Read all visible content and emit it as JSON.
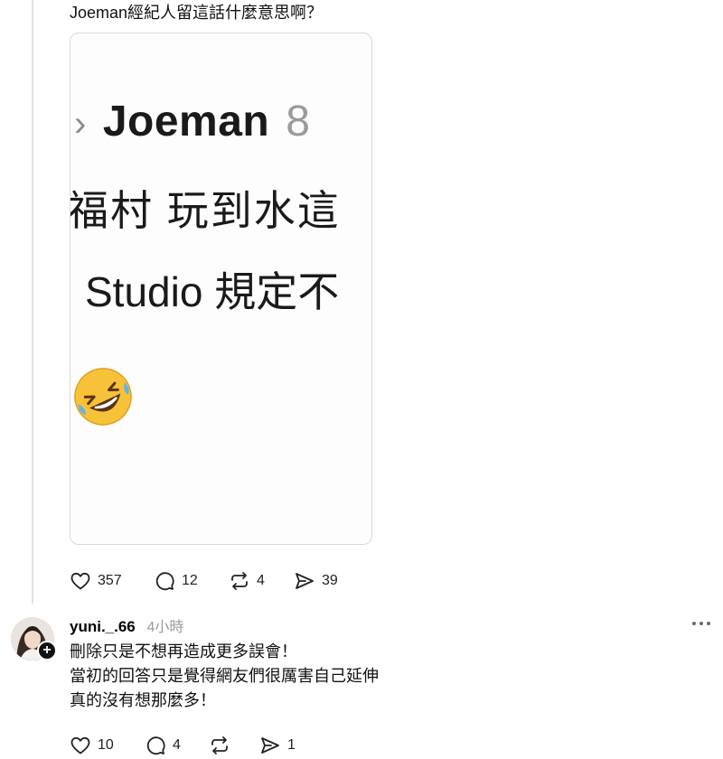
{
  "post": {
    "text": "Joeman經紀人留這話什麼意思啊？",
    "image": {
      "line1_name": "Joeman",
      "line1_count": "8",
      "line2": "福村 玩到水這",
      "line3": "Studio 規定不"
    },
    "actions": {
      "likes": "357",
      "comments": "12",
      "reposts": "4",
      "shares": "39"
    }
  },
  "reply": {
    "username": "yuni._.66",
    "time": "4小時",
    "lines": [
      "刪除只是不想再造成更多誤會！",
      "當初的回答只是覺得網友們很厲害自己延伸",
      "真的沒有想那麼多！"
    ],
    "actions": {
      "likes": "10",
      "comments": "4",
      "reposts": "",
      "shares": "1"
    }
  },
  "icons": {
    "like": "heart-icon",
    "comment": "comment-bubble-icon",
    "repost": "repost-arrows-icon",
    "share": "send-arrow-icon",
    "more": "more-dots-icon",
    "follow": "plus-icon",
    "emoji": "rolling-on-floor-laughing-emoji"
  }
}
